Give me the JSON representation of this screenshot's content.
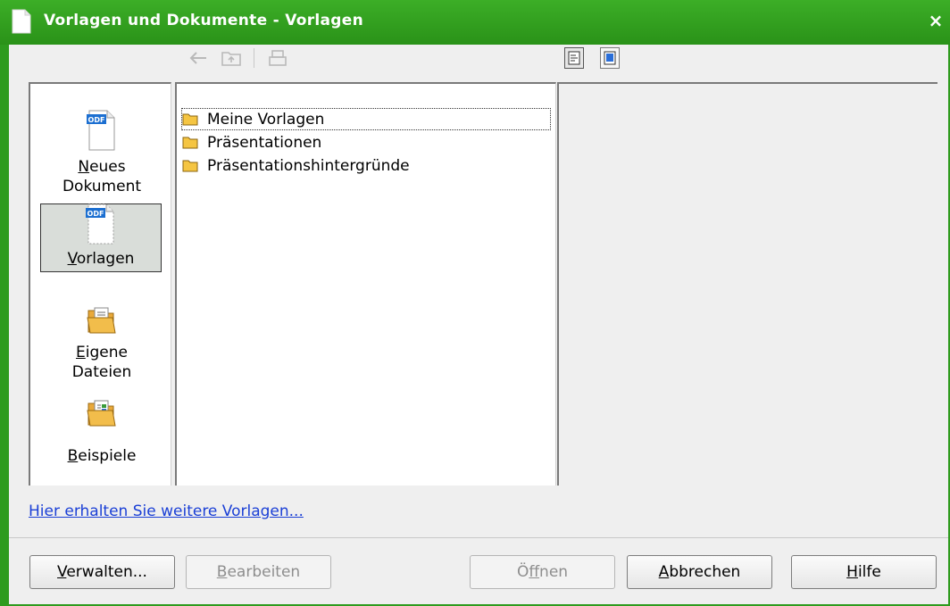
{
  "window": {
    "title": "Vorlagen und Dokumente - Vorlagen",
    "close_label": "×"
  },
  "toolbar": {
    "back_icon": "back-arrow-icon",
    "up_icon": "folder-up-icon",
    "print_icon": "print-icon",
    "view_document_icon": "document-view-icon",
    "view_preview_icon": "preview-icon"
  },
  "sidebar": {
    "items": [
      {
        "label_u": "N",
        "label_rest": "eues",
        "label_line2": "Dokument",
        "icon": "odf-document-icon",
        "selected": false
      },
      {
        "label_u": "V",
        "label_rest": "orlagen",
        "label_line2": "",
        "icon": "odf-document-icon",
        "selected": true
      },
      {
        "label_u": "E",
        "label_rest": "igene",
        "label_line2": "Dateien",
        "icon": "folder-documents-icon",
        "selected": false
      },
      {
        "label_u": "B",
        "label_rest": "eispiele",
        "label_line2": "",
        "icon": "folder-examples-icon",
        "selected": false
      }
    ],
    "odf_badge": "ODF"
  },
  "tree": {
    "items": [
      {
        "label": "Meine Vorlagen"
      },
      {
        "label": "Präsentationen"
      },
      {
        "label": "Präsentationshintergründe"
      }
    ]
  },
  "link": {
    "text": "Hier erhalten Sie weitere Vorlagen..."
  },
  "buttons": {
    "manage": {
      "u": "V",
      "rest": "erwalten..."
    },
    "edit": {
      "u": "B",
      "rest": "earbeiten"
    },
    "open": {
      "pre": "Ö",
      "u": "f",
      "rest": "fnen"
    },
    "cancel": {
      "u": "A",
      "rest": "bbrechen"
    },
    "help": {
      "u": "H",
      "rest": "ilfe"
    }
  },
  "colors": {
    "titlebar": "#2e9b1e",
    "link": "#1a3fd6",
    "folder": "#f5c542"
  }
}
